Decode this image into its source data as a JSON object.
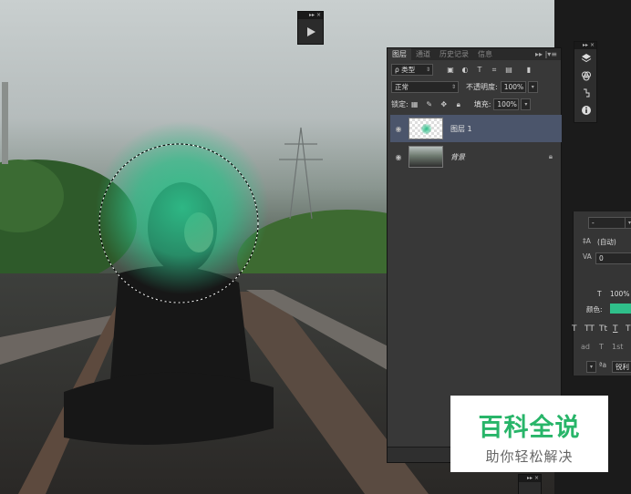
{
  "layers_panel": {
    "tabs": [
      "图层",
      "通道",
      "历史记录",
      "信息"
    ],
    "kind_label": "ρ 类型",
    "blend_mode": "正常",
    "opacity_label": "不透明度:",
    "opacity_value": "100%",
    "lock_label": "锁定:",
    "fill_label": "填充:",
    "fill_value": "100%",
    "layers": [
      {
        "name": "图层 1",
        "selected": true
      },
      {
        "name": "背景",
        "locked": true
      }
    ]
  },
  "character_panel": {
    "auto_value": "(自动)",
    "tracking_value": "0",
    "scale_value": "100%",
    "color_label": "颜色:",
    "color_value": "#2fbf8a",
    "aa_label": "ªa",
    "aa_value": "锐利"
  },
  "icons": {
    "mini_panel": "play-icon",
    "strip": [
      "layers-icon",
      "channels-icon",
      "history-icon",
      "info-icon"
    ]
  },
  "watermark": {
    "title": "百科全说",
    "subtitle": "助你轻松解决"
  },
  "colors": {
    "brush_green": "#2fbf8a",
    "panel_bg": "#383838",
    "selected_layer": "#4b556b",
    "watermark_green": "#28b569"
  }
}
